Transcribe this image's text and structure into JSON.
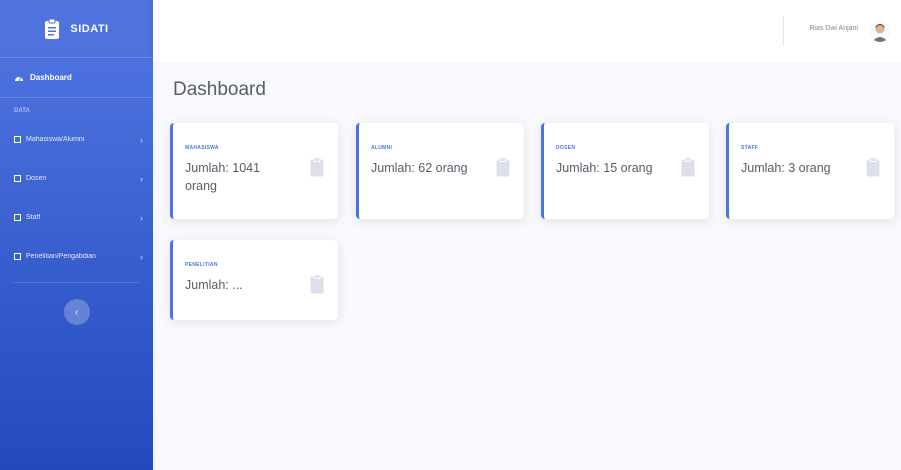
{
  "brand": {
    "name": "SIDATI",
    "icon": "clipboard-icon"
  },
  "sidebar": {
    "dashboard": {
      "label": "Dashboard",
      "icon": "tachometer-icon"
    },
    "heading": "Data",
    "items": [
      {
        "label": "Mahasiswa/Alumni",
        "icon": "folder-icon"
      },
      {
        "label": "Dosen",
        "icon": "folder-icon"
      },
      {
        "label": "Staff",
        "icon": "folder-icon"
      },
      {
        "label": "Penelitian/Pengabdian",
        "icon": "folder-icon"
      }
    ],
    "toggle_icon": "chevron-left-icon"
  },
  "topbar": {
    "username": "Rias Dwi Anjani",
    "avatar_icon": "user-avatar-icon"
  },
  "page": {
    "title": "Dashboard"
  },
  "cards": [
    {
      "label": "Mahasiswa",
      "value": "Jumlah: 1041 orang",
      "icon": "clipboard-icon"
    },
    {
      "label": "Alumni",
      "value": "Jumlah: 62 orang",
      "icon": "clipboard-icon"
    },
    {
      "label": "Dosen",
      "value": "Jumlah: 15 orang",
      "icon": "clipboard-icon"
    },
    {
      "label": "Staff",
      "value": "Jumlah: 3 orang",
      "icon": "clipboard-icon"
    },
    {
      "label": "Penelitian",
      "value": "Jumlah: ...",
      "icon": "clipboard-icon"
    }
  ],
  "colors": {
    "primary": "#4e73df",
    "sidebar_dark": "#224abe",
    "text": "#5a5c69",
    "background": "#f8f9fc"
  }
}
